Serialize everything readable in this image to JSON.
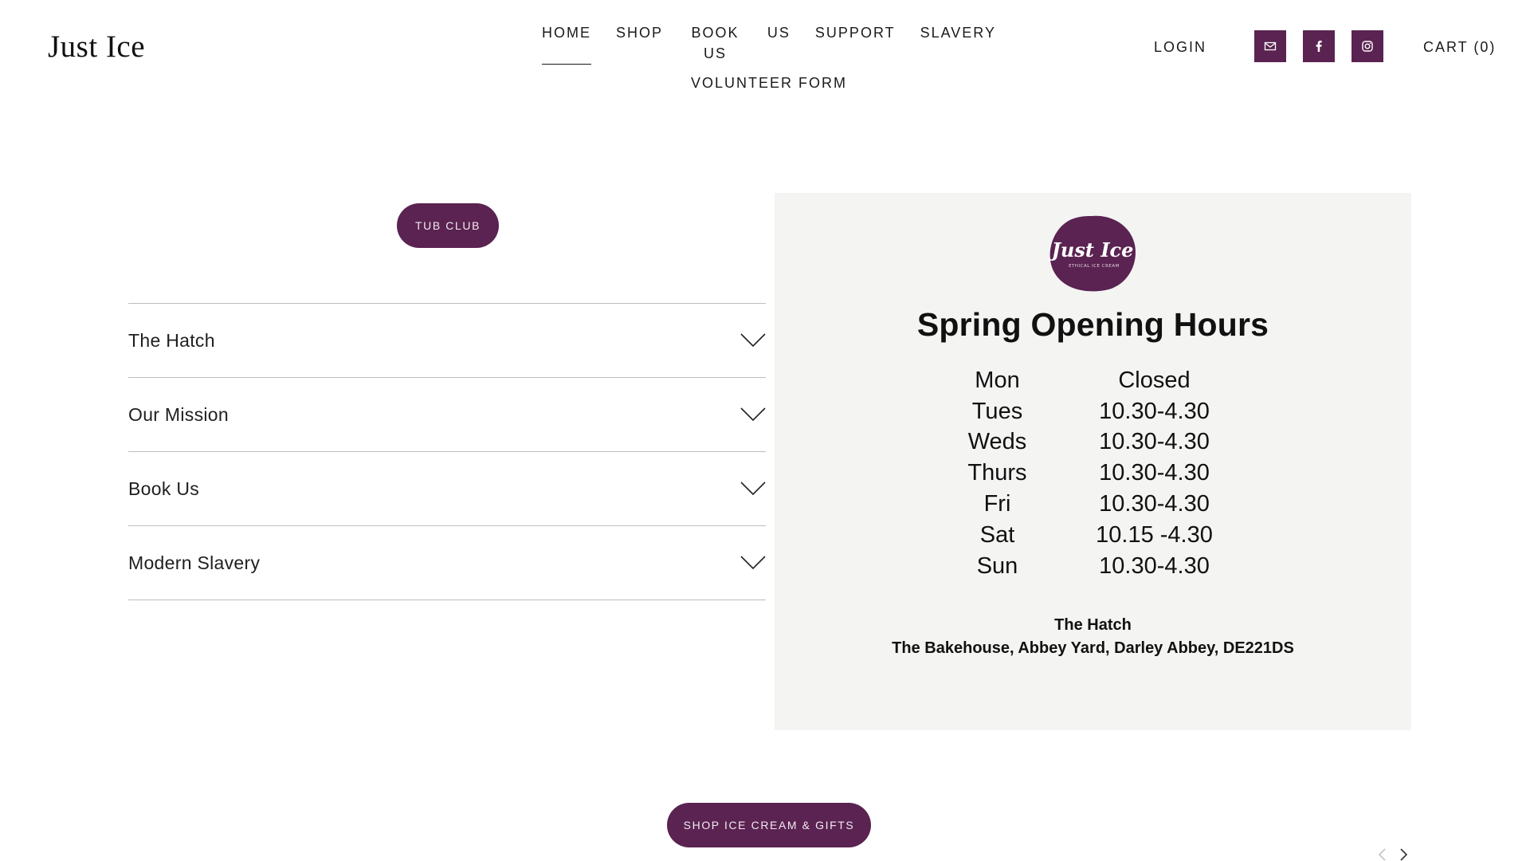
{
  "header": {
    "logo": "Just Ice",
    "nav": [
      "HOME",
      "SHOP",
      "BOOK US",
      "US",
      "SUPPORT",
      "SLAVERY"
    ],
    "nav_second": "VOLUNTEER FORM",
    "login": "LOGIN",
    "social": [
      "mail-icon",
      "facebook-icon",
      "instagram-icon"
    ],
    "cart": "CART (0)"
  },
  "colors": {
    "brand": "#5a2351",
    "panel_bg": "#f4f4f3",
    "divider": "#bdbdbd"
  },
  "tub_club": "TUB CLUB",
  "accordion": [
    "The Hatch",
    "Our Mission",
    "Book Us",
    "Modern Slavery"
  ],
  "hours_panel": {
    "logo_text": "Just Ice",
    "logo_subtext": "ETHICAL ICE CREAM",
    "title": "Spring Opening Hours",
    "rows": [
      {
        "day": "Mon",
        "time": "Closed"
      },
      {
        "day": "Tues",
        "time": "10.30-4.30"
      },
      {
        "day": "Weds",
        "time": "10.30-4.30"
      },
      {
        "day": "Thurs",
        "time": "10.30-4.30"
      },
      {
        "day": "Fri",
        "time": "10.30-4.30"
      },
      {
        "day": "Sat",
        "time": "10.15 -4.30"
      },
      {
        "day": "Sun",
        "time": "10.30-4.30"
      }
    ],
    "address_line1": "The Hatch",
    "address_line2": "The Bakehouse, Abbey Yard, Darley Abbey, DE221DS"
  },
  "shop_button": "SHOP ICE CREAM & GIFTS"
}
